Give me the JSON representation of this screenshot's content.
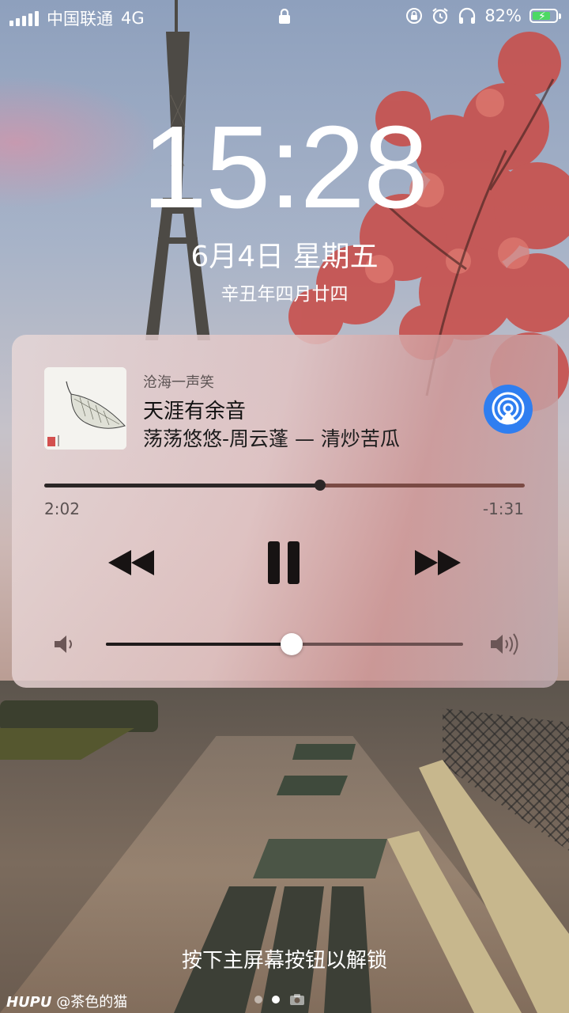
{
  "status_bar": {
    "carrier": "中国联通",
    "network": "4G",
    "battery_percent": "82%",
    "battery_level": 0.82,
    "icons": [
      "signal-icon",
      "lock-icon",
      "rotation-lock-icon",
      "alarm-icon",
      "headphones-icon",
      "battery-charging-icon"
    ]
  },
  "lock_screen": {
    "time": "15:28",
    "date": "6月4日 星期五",
    "lunar_date": "辛丑年四月廿四",
    "unlock_hint": "按下主屏幕按钮以解锁"
  },
  "now_playing": {
    "source_label": "沧海一声笑",
    "title": "天涯有余音",
    "subtitle": "荡荡悠悠-周云蓬 — 清炒苦瓜",
    "elapsed": "2:02",
    "remaining": "-1:31",
    "progress_fraction": 0.574,
    "volume_fraction": 0.52,
    "accent_color": "#2f7ef0",
    "controls": [
      "rewind-icon",
      "pause-icon",
      "fast-forward-icon",
      "airplay-icon",
      "volume-low-icon",
      "volume-high-icon"
    ]
  },
  "page_indicator": {
    "pages": 2,
    "current": 2,
    "extra": "camera-icon"
  },
  "watermark": {
    "brand": "HUPU",
    "user": "@茶色的猫"
  }
}
